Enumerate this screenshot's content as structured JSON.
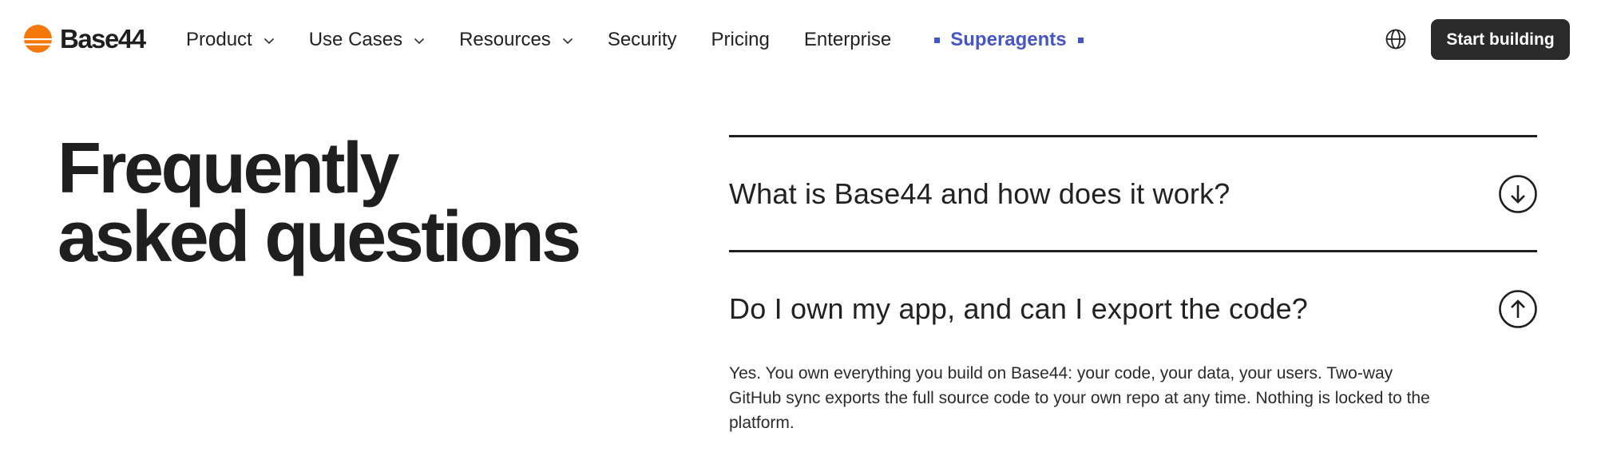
{
  "brand": {
    "name": "Base44",
    "logo_color": "#f5780a"
  },
  "nav": {
    "items": [
      {
        "label": "Product",
        "has_dropdown": true
      },
      {
        "label": "Use Cases",
        "has_dropdown": true
      },
      {
        "label": "Resources",
        "has_dropdown": true
      },
      {
        "label": "Security",
        "has_dropdown": false
      },
      {
        "label": "Pricing",
        "has_dropdown": false
      },
      {
        "label": "Enterprise",
        "has_dropdown": false
      }
    ],
    "highlight": {
      "label": "Superagents",
      "color": "#4656c8"
    },
    "language_icon": "globe-icon",
    "cta_label": "Start building"
  },
  "faq": {
    "title_line1": "Frequently",
    "title_line2": "asked questions",
    "questions": [
      {
        "question": "What is Base44 and how does it work?",
        "expanded": false,
        "toggle_icon": "arrow-down-circle-icon"
      },
      {
        "question": "Do I own my app, and can I export the code?",
        "expanded": true,
        "toggle_icon": "arrow-up-circle-icon",
        "answer": "Yes. You own everything you build on Base44: your code, your data, your users. Two-way GitHub sync exports the full source code to your own repo at any time. Nothing is locked to the platform."
      }
    ]
  }
}
